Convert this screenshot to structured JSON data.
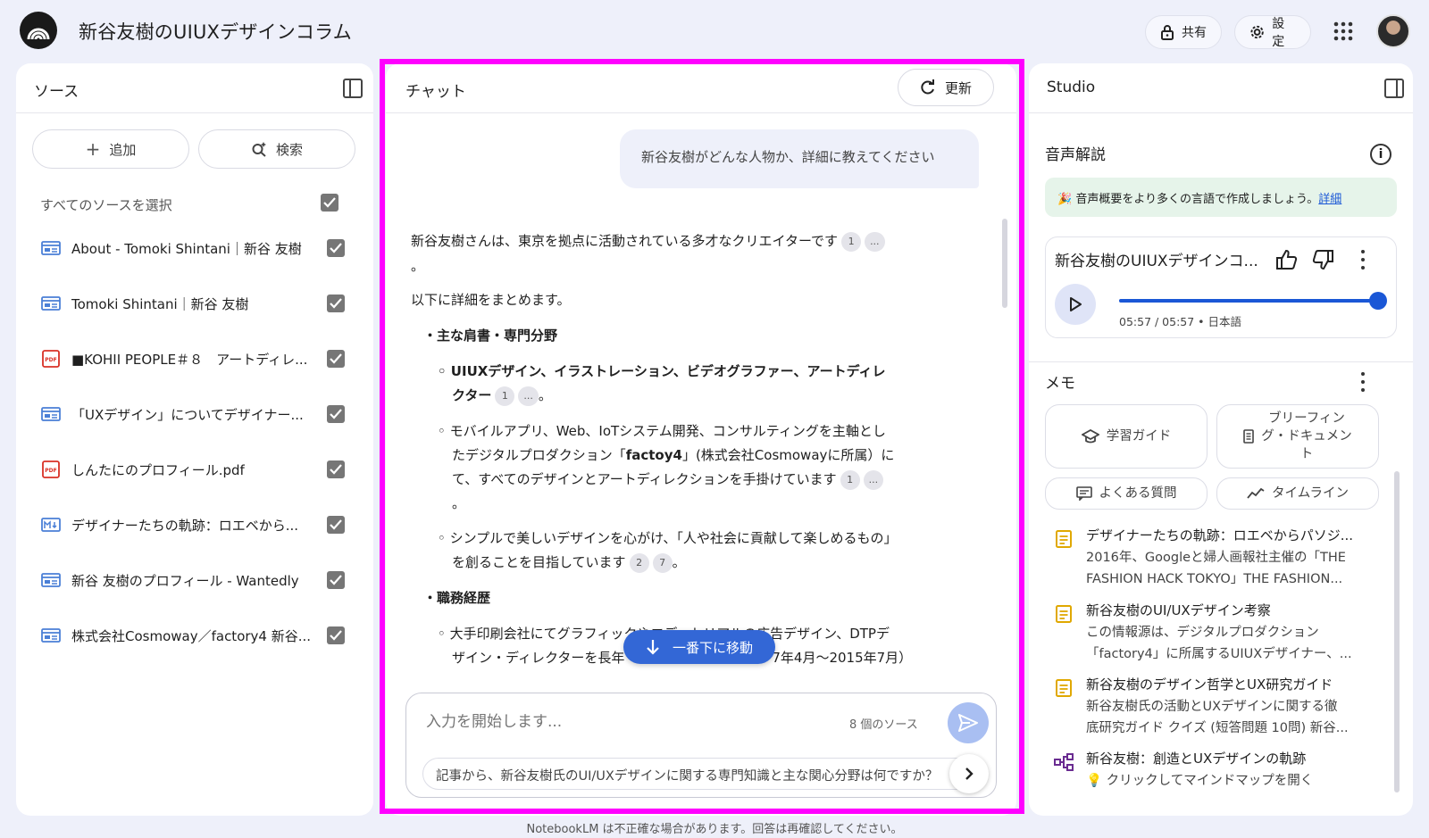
{
  "app": {
    "title": "新谷友樹のUIUXデザインコラム",
    "share_label": "共有",
    "settings_label": "設定"
  },
  "sources": {
    "title": "ソース",
    "add_label": "追加",
    "search_label": "検索",
    "select_all_label": "すべてのソースを選択",
    "items": [
      {
        "label": "About - Tomoki Shintani｜新谷 友樹",
        "icon": "web-page-icon"
      },
      {
        "label": "Tomoki Shintani｜新谷 友樹",
        "icon": "web-page-icon"
      },
      {
        "label": "■KOHII PEOPLE＃８　アートディレ...",
        "icon": "pdf-icon"
      },
      {
        "label": "「UXデザイン」についてデザイナー...",
        "icon": "web-page-icon"
      },
      {
        "label": "しんたにのプロフィール.pdf",
        "icon": "pdf-icon"
      },
      {
        "label": "デザイナーたちの軌跡：ロエベから...",
        "icon": "markdown-icon"
      },
      {
        "label": "新谷 友樹のプロフィール - Wantedly",
        "icon": "web-page-icon"
      },
      {
        "label": "株式会社Cosmoway／factory4 新谷...",
        "icon": "web-page-icon"
      }
    ]
  },
  "chat": {
    "title": "チャット",
    "refresh_label": "更新",
    "user_message": "新谷友樹がどんな人物か、詳細に教えてください",
    "answer": {
      "intro_line1": "新谷友樹さんは、東京を拠点に活動されている多才なクリエイターです",
      "intro_line1_cites": [
        "1",
        "..."
      ],
      "intro_line2": "。",
      "summary": "以下に詳細をまとめます。",
      "section1_title": "・主な肩書・専門分野",
      "s1_item1_line1": "◦ UIUXデザイン、イラストレーション、ビデオグラファー、アートディレ",
      "s1_item1_line2": "クター",
      "s1_item1_cites": [
        "1",
        "..."
      ],
      "s1_item1_end": "。",
      "s1_item2_line1": "◦ モバイルアプリ、Web、IoTシステム開発、コンサルティングを主軸とし",
      "s1_item2_line2_pre": "たデジタルプロダクション「",
      "s1_item2_line2_bold": "factoy4",
      "s1_item2_line2_post": "」(株式会社Cosmowayに所属）に",
      "s1_item2_line3": "て、すべてのデザインとアートディレクションを手掛けています",
      "s1_item2_cites": [
        "1",
        "..."
      ],
      "s1_item2_end": "。",
      "s1_item3_line1": "◦ シンプルで美しいデザインを心がけ、「人や社会に貢献して楽しめるもの」",
      "s1_item3_line2": "を創ることを目指しています",
      "s1_item3_cites": [
        "2",
        "7"
      ],
      "s1_item3_end": "。",
      "section2_title": "・職務経歴",
      "s2_item1_line1": "◦ 大手印刷会社にてグラフィックやエディトリアルの広告デザイン、DTPデ",
      "s2_item1_line2": "ザイン・ディレクターを長年　　　　　　　　　　　7年4月〜2015年7月）"
    },
    "scroll_down_label": "一番下に移動",
    "input_placeholder": "入力を開始します...",
    "source_count": "8 個のソース",
    "suggestion": "記事から、新谷友樹氏のUI/UXデザインに関する専門知識と主な関心分野は何ですか？"
  },
  "studio": {
    "title": "Studio",
    "audio_section_title": "音声解説",
    "promo_text": "🎉 音声概要をより多くの言語で作成しましょう。",
    "promo_link": "詳細",
    "audio_title": "新谷友樹のUIUXデザインコ...",
    "audio_progress": 1.0,
    "audio_time": "05:57 / 05:57 • 日本語",
    "memo_title": "メモ",
    "memo_buttons": {
      "study_guide": "学習ガイド",
      "briefing_line1": "ブリーフィン",
      "briefing_line2": "グ・ドキュメン",
      "briefing_line3": "ト",
      "faq": "よくある質問",
      "timeline": "タイムライン"
    },
    "notes": [
      {
        "title": "デザイナーたちの軌跡：ロエベからパソジ...",
        "body1": "2016年、Googleと婦人画報社主催の「THE",
        "body2": "FASHION HACK TOKYO」THE FASHION..."
      },
      {
        "title": "新谷友樹のUI/UXデザイン考察",
        "body1": "この情報源は、デジタルプロダクション",
        "body2": "「factory4」に所属するUIUXデザイナー、..."
      },
      {
        "title": "新谷友樹のデザイン哲学とUX研究ガイド",
        "body1": "新谷友樹氏の活動とUXデザインに関する徹",
        "body2": "底研究ガイド クイズ (短答問題 10問) 新谷..."
      },
      {
        "title": "新谷友樹：創造とUXデザインの軌跡",
        "body1": "💡 クリックしてマインドマップを開く",
        "body2": ""
      }
    ]
  },
  "footer": {
    "note": "NotebookLM は不正確な場合があります。回答は再確認してください。"
  },
  "colors": {
    "accent": "#1a57d6",
    "highlight_border": "#ff00ff",
    "background": "#eef0fa"
  }
}
